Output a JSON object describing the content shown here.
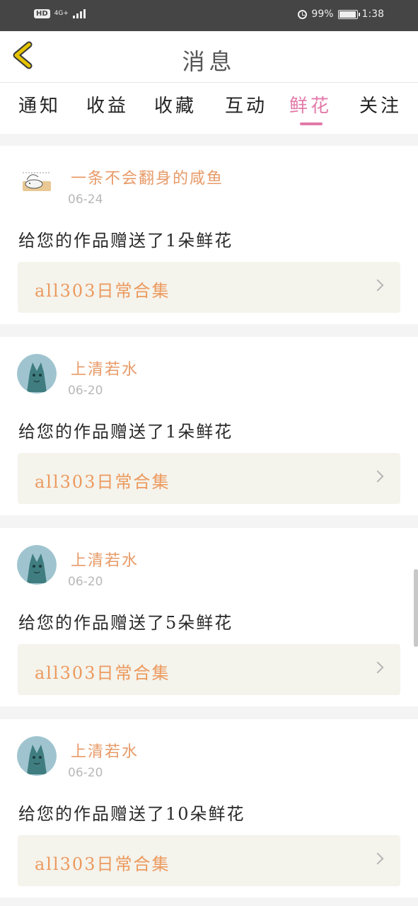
{
  "status_bar": {
    "hd": "HD",
    "network": "4G+",
    "battery_text": "99%",
    "time": "1:38",
    "battery_level": 0.99
  },
  "header": {
    "title": "消息",
    "back_icon": "chevron-left-icon",
    "accent_color": "#e6c400"
  },
  "tabs": [
    {
      "label": "通知",
      "active": false
    },
    {
      "label": "收益",
      "active": false
    },
    {
      "label": "收藏",
      "active": false
    },
    {
      "label": "互动",
      "active": false
    },
    {
      "label": "鲜花",
      "active": true
    },
    {
      "label": "关注",
      "active": false
    }
  ],
  "colors": {
    "active_tab": "#e27aa8",
    "user_name": "#e79a67",
    "work_title": "#ec9a5e"
  },
  "messages": [
    {
      "user_name": "一条不会翻身的咸鱼",
      "date": "06-24",
      "text": "给您的作品赠送了1朵鲜花",
      "work_title": "all303日常合集",
      "avatar": "fish-avatar"
    },
    {
      "user_name": "上清若水",
      "date": "06-20",
      "text": "给您的作品赠送了1朵鲜花",
      "work_title": "all303日常合集",
      "avatar": "cat-avatar"
    },
    {
      "user_name": "上清若水",
      "date": "06-20",
      "text": "给您的作品赠送了5朵鲜花",
      "work_title": "all303日常合集",
      "avatar": "cat-avatar"
    },
    {
      "user_name": "上清若水",
      "date": "06-20",
      "text": "给您的作品赠送了10朵鲜花",
      "work_title": "all303日常合集",
      "avatar": "cat-avatar"
    }
  ]
}
